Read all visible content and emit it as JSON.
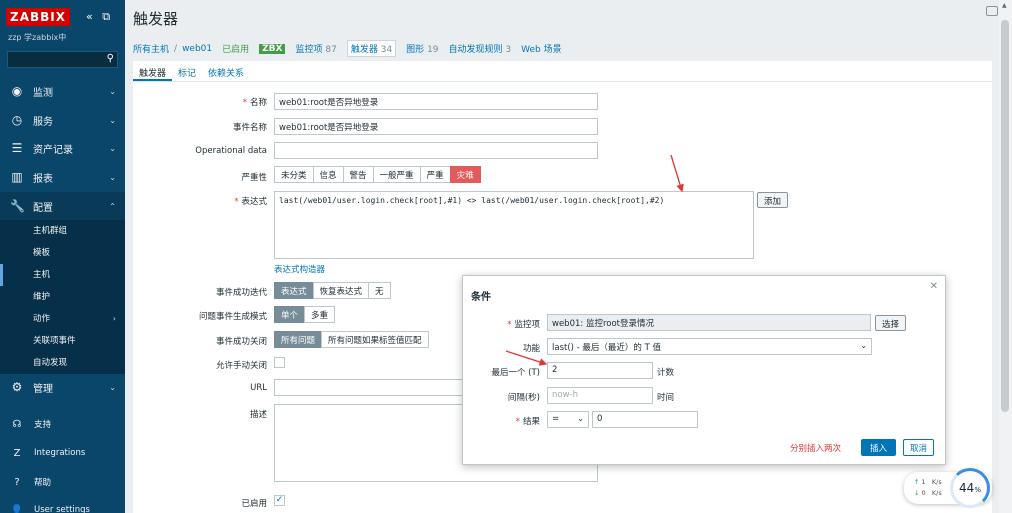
{
  "sidebar": {
    "logo": "ZABBIX",
    "server_name": "zzp 学zabbix中",
    "menu": [
      {
        "label": "监测",
        "icon": "eye-icon"
      },
      {
        "label": "服务",
        "icon": "clock-icon"
      },
      {
        "label": "资产记录",
        "icon": "list-icon"
      },
      {
        "label": "报表",
        "icon": "bar-chart-icon"
      },
      {
        "label": "配置",
        "icon": "wrench-icon"
      }
    ],
    "submenu": [
      "主机群组",
      "模板",
      "主机",
      "维护",
      "动作",
      "关联项事件",
      "自动发现"
    ],
    "admin": "管理",
    "bottom": [
      "支持",
      "Integrations",
      "帮助",
      "User settings"
    ]
  },
  "page": {
    "title": "触发器"
  },
  "topnav": {
    "all_hosts": "所有主机",
    "host": "web01",
    "enabled": "已启用",
    "zbx": "ZBX",
    "items": "监控项",
    "items_count": "87",
    "triggers": "触发器",
    "triggers_count": "34",
    "graphs": "图形",
    "graphs_count": "19",
    "discovery": "自动发现规则",
    "discovery_count": "3",
    "web": "Web 场景"
  },
  "tabs": [
    "触发器",
    "标记",
    "依赖关系"
  ],
  "form": {
    "name_label": "名称",
    "name_value": "web01:root是否异地登录",
    "event_name_label": "事件名称",
    "event_name_value": "web01:root是否异地登录",
    "opdata_label": "Operational data",
    "opdata_value": "",
    "severity_label": "严重性",
    "severity": [
      "未分类",
      "信息",
      "警告",
      "一般严重",
      "严重",
      "灾难"
    ],
    "expression_label": "表达式",
    "expression_value": "last(/web01/user.login.check[root],#1) <> last(/web01/user.login.check[root],#2)",
    "add_button": "添加",
    "expr_constructor": "表达式构造器",
    "ok_event_label": "事件成功迭代",
    "ok_event": [
      "表达式",
      "恢复表达式",
      "无"
    ],
    "problem_mode_label": "问题事件生成模式",
    "problem_mode": [
      "单个",
      "多重"
    ],
    "ok_close_label": "事件成功关闭",
    "ok_close": [
      "所有问题",
      "所有问题如果标签值匹配"
    ],
    "manual_close_label": "允许手动关闭",
    "url_label": "URL",
    "desc_label": "描述",
    "enabled_label": "已启用"
  },
  "dialog": {
    "title": "条件",
    "item_label": "监控项",
    "item_value": "web01: 监控root登录情况",
    "select_button": "选择",
    "function_label": "功能",
    "function_value": "last() - 最后（最近）的 T 值",
    "last_label": "最后一个 (T)",
    "last_value": "2",
    "last_unit": "计数",
    "interval_label": "间隔(秒)",
    "interval_placeholder": "now-h",
    "interval_unit": "时间",
    "result_label": "结果",
    "result_op": "=",
    "result_value": "0",
    "note": "分别插入两次",
    "insert_button": "插入",
    "cancel_button": "取消"
  },
  "widget": {
    "up": "1",
    "down": "0",
    "unit": "K/s",
    "percent": "44",
    "percent_unit": "%"
  },
  "colors": {
    "sidebar": "#0a466a",
    "link": "#0275b8",
    "disaster": "#e45959",
    "enabled": "#429e47",
    "annotation": "#e33734"
  }
}
